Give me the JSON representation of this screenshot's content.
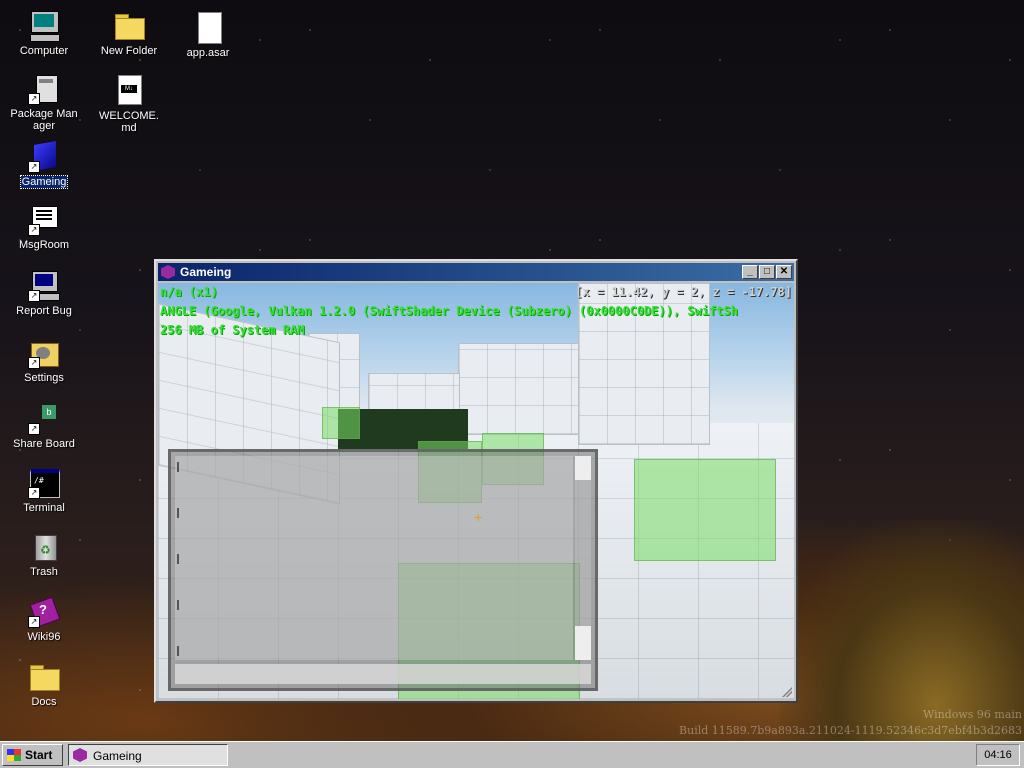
{
  "desktop": {
    "icons": [
      {
        "label": "Computer",
        "icon": "computer-icon"
      },
      {
        "label": "Package Manager",
        "icon": "package-manager-icon"
      },
      {
        "label": "Gameing",
        "icon": "gameing-icon",
        "selected": true
      },
      {
        "label": "MsgRoom",
        "icon": "msgroom-icon"
      },
      {
        "label": "Report Bug",
        "icon": "report-bug-icon"
      },
      {
        "label": "Settings",
        "icon": "settings-icon"
      },
      {
        "label": "Share Board",
        "icon": "share-board-icon"
      },
      {
        "label": "Terminal",
        "icon": "terminal-icon"
      },
      {
        "label": "Trash",
        "icon": "trash-icon"
      },
      {
        "label": "Wiki96",
        "icon": "wiki96-icon"
      },
      {
        "label": "Docs",
        "icon": "folder-icon"
      },
      {
        "label": "New Folder",
        "icon": "folder-icon"
      },
      {
        "label": "WELCOME.md",
        "icon": "markdown-file-icon"
      },
      {
        "label": "app.asar",
        "icon": "file-icon"
      }
    ]
  },
  "window": {
    "title": "Gameing",
    "hud": {
      "mode": "n/a (x1)",
      "coords": "[x = 11.42, y = 2, z = -17.78]",
      "renderer": "ANGLE (Google, Vulkan 1.2.0 (SwiftShader Device (Subzero) (0x0000C0DE)), SwiftSh",
      "memory": "256 MB of System RAM"
    }
  },
  "watermark": {
    "line1": "Windows 96 main",
    "line2": "Build 11589.7b9a893a.211024-1119.52346c3d7ebf4b3d2683"
  },
  "taskbar": {
    "start_label": "Start",
    "task_label": "Gameing",
    "clock": "04:16"
  },
  "colors": {
    "hud_text": "#3fdc3f",
    "title_bar": "#0a246a",
    "selection": "#0a246a"
  }
}
